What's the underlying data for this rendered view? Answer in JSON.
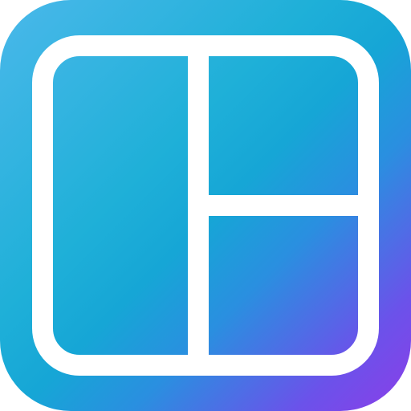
{
  "icon": {
    "name": "collage-layout-app-icon",
    "gradient_colors": [
      "#4ab8ea",
      "#1fb0d8",
      "#16a6d6",
      "#2a8fe0",
      "#6b52ea",
      "#8b3ee8"
    ],
    "glyph_color": "#ffffff"
  }
}
